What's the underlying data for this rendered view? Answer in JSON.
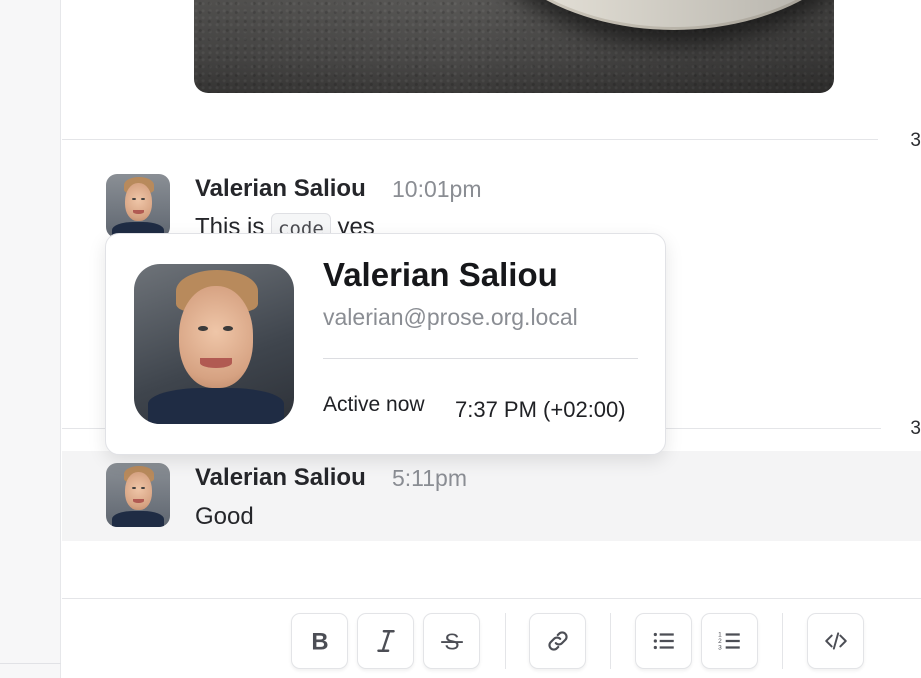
{
  "messages": [
    {
      "author": "Valerian Saliou",
      "time": "10:01pm",
      "text_before": "This is",
      "code": "code",
      "text_after": "yes"
    },
    {
      "author": "Valerian Saliou",
      "time": "5:11pm",
      "text": "Good"
    }
  ],
  "edge_numbers": [
    "3",
    "3"
  ],
  "profile_popover": {
    "name": "Valerian Saliou",
    "email": "valerian@prose.org.local",
    "status": "Active now",
    "local_time": "7:37 PM (+02:00)"
  },
  "toolbar": {
    "buttons": [
      {
        "name": "bold-button",
        "icon": "bold-icon"
      },
      {
        "name": "italic-button",
        "icon": "italic-icon"
      },
      {
        "name": "strikethrough-button",
        "icon": "strikethrough-icon"
      },
      {
        "name": "link-button",
        "icon": "link-icon"
      },
      {
        "name": "bullet-list-button",
        "icon": "bullet-list-icon"
      },
      {
        "name": "numbered-list-button",
        "icon": "numbered-list-icon"
      },
      {
        "name": "code-button",
        "icon": "code-icon"
      }
    ]
  },
  "colors": {
    "text": "#25262a",
    "muted": "#8a8d93",
    "highlight_row": "#f4f4f5",
    "border": "#e1e2e6"
  }
}
